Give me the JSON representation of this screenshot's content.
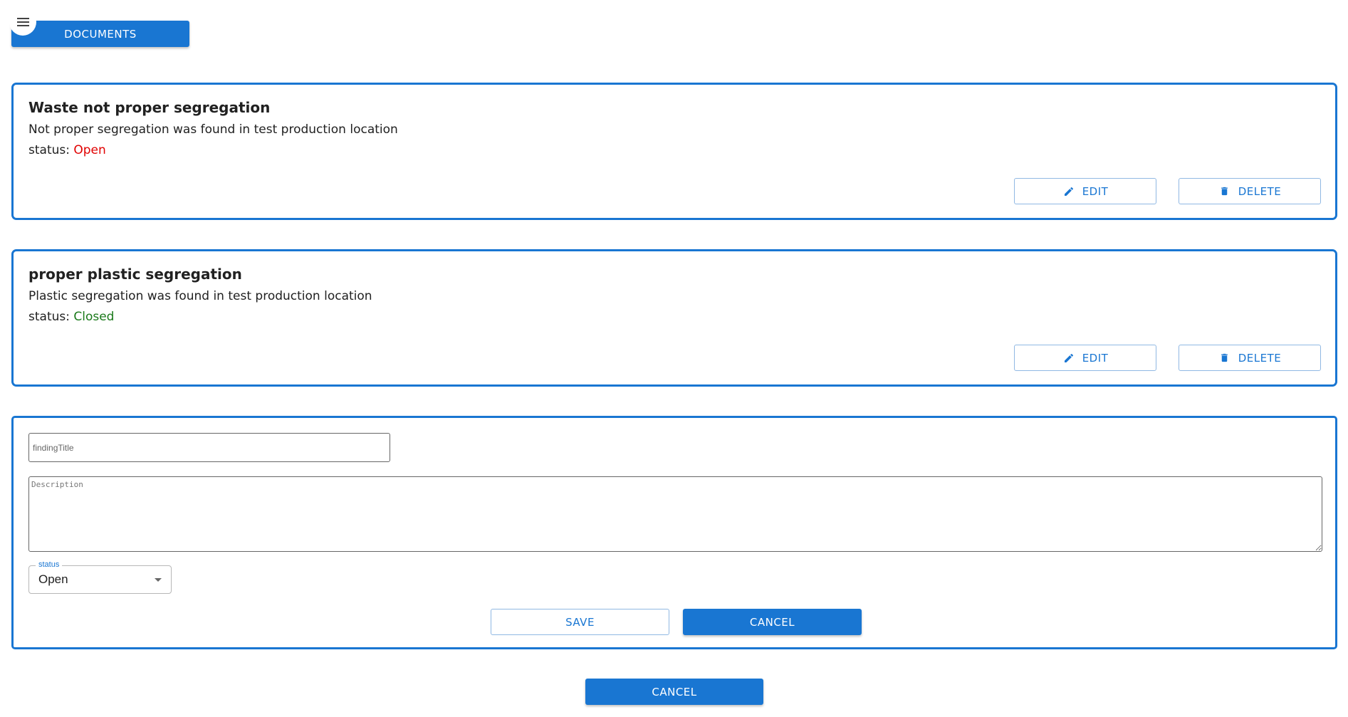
{
  "header": {
    "documents_label": "DOCUMENTS",
    "menu_icon": "hamburger-menu-icon"
  },
  "findings": [
    {
      "title": "Waste not proper segregation",
      "description": "Not proper segregation was found in test production location",
      "status_prefix": "status: ",
      "status": "Open",
      "status_color": "#e10000",
      "edit_label": "EDIT",
      "delete_label": "DELETE"
    },
    {
      "title": "proper plastic segregation",
      "description": "Plastic segregation was found in test production location",
      "status_prefix": "status: ",
      "status": "Closed",
      "status_color": "#1b7a1b",
      "edit_label": "EDIT",
      "delete_label": "DELETE"
    }
  ],
  "form": {
    "title_placeholder": "findingTitle",
    "description_placeholder": "Description",
    "status_label": "status",
    "status_value": "Open",
    "save_label": "SAVE",
    "cancel_label": "CANCEL"
  },
  "footer": {
    "cancel_label": "CANCEL"
  },
  "colors": {
    "primary": "#1976d2",
    "open": "#e10000",
    "closed": "#1b7a1b"
  }
}
